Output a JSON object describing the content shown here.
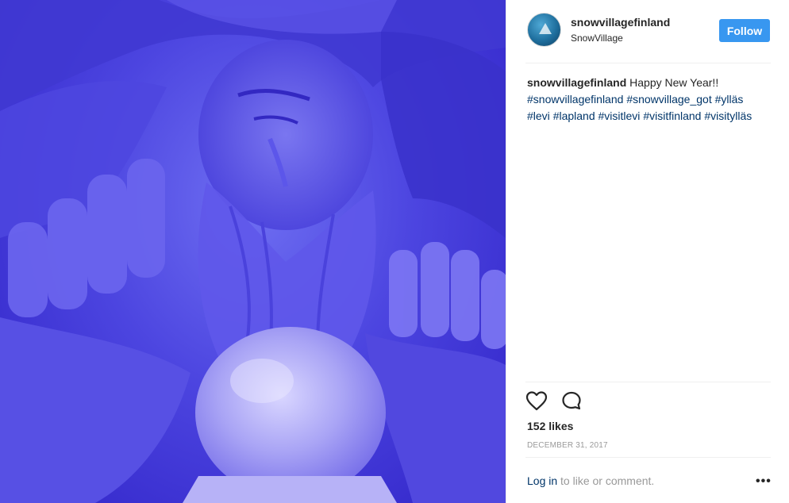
{
  "post": {
    "image_alt": "Snow sculpture of a wizard holding an ice crystal ball, lit in blue",
    "colors": {
      "photo_blue": "#4c45e0",
      "follow_button": "#3897f0",
      "link": "#003569",
      "muted": "#999999"
    }
  },
  "header": {
    "username": "snowvillagefinland",
    "location": "SnowVillage",
    "follow_label": "Follow",
    "avatar_icon": "snow-mountain-avatar"
  },
  "caption": {
    "username": "snowvillagefinland",
    "text": "Happy New Year!!",
    "hashtags": [
      "#snowvillagefinland",
      "#snowvillage_got",
      "#ylläs",
      "#levi",
      "#lapland",
      "#visitlevi",
      "#visitfinland",
      "#visitylläs"
    ]
  },
  "actions": {
    "like_icon": "heart-icon",
    "comment_icon": "comment-icon"
  },
  "stats": {
    "likes": "152 likes",
    "date": "DECEMBER 31, 2017"
  },
  "footer": {
    "login_link": "Log in",
    "login_suffix": " to like or comment.",
    "more_label": "•••"
  }
}
